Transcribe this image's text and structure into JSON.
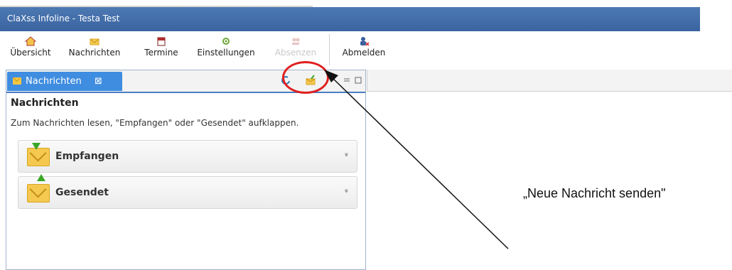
{
  "window": {
    "title": "ClaXss Infoline - Testa Test"
  },
  "toolbar": {
    "items": [
      {
        "label": "Übersicht",
        "icon": "home-icon"
      },
      {
        "label": "Nachrichten",
        "icon": "mail-icon"
      },
      {
        "label": "Termine",
        "icon": "calendar-icon"
      },
      {
        "label": "Einstellungen",
        "icon": "settings-icon"
      },
      {
        "label": "Absenzen",
        "icon": "absences-icon",
        "disabled": true
      },
      {
        "label": "Abmelden",
        "icon": "logout-icon"
      }
    ]
  },
  "panel": {
    "tab_title": "Nachrichten",
    "tab_close": "⊠",
    "heading": "Nachrichten",
    "hint": "Zum Nachrichten lesen, \"Empfangen\" oder \"Gesendet\" aufklappen.",
    "sections": [
      {
        "label": "Empfangen",
        "chevron": "»"
      },
      {
        "label": "Gesendet",
        "chevron": "»"
      }
    ]
  },
  "annotation": {
    "text": "„Neue Nachricht senden\""
  },
  "colors": {
    "titlebar": "#3f6aa6",
    "tab": "#3f8de0",
    "highlight_oval": "#e02020"
  }
}
